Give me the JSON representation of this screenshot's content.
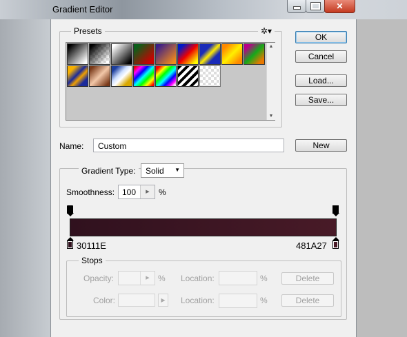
{
  "window": {
    "title": "Gradient Editor"
  },
  "presets": {
    "label": "Presets"
  },
  "buttons": {
    "ok": "OK",
    "cancel": "Cancel",
    "load": "Load...",
    "save": "Save...",
    "new": "New"
  },
  "name_field": {
    "label": "Name:",
    "value": "Custom"
  },
  "gradient_type": {
    "label": "Gradient Type:",
    "value": "Solid"
  },
  "smoothness": {
    "label": "Smoothness:",
    "value": "100",
    "unit": "%"
  },
  "gradient": {
    "left_color": "#30111E",
    "right_color": "#481A27",
    "left_label": "30111E",
    "right_label": "481A27"
  },
  "stops": {
    "label": "Stops",
    "opacity_label": "Opacity:",
    "opacity_unit": "%",
    "location_label": "Location:",
    "location_unit": "%",
    "color_label": "Color:",
    "delete_label": "Delete"
  }
}
